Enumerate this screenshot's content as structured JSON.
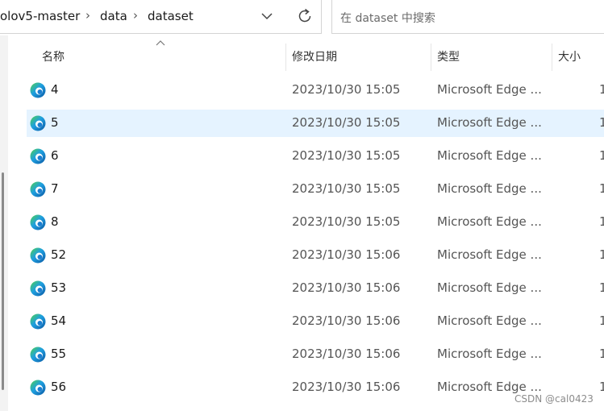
{
  "breadcrumb": [
    "olov5-master",
    "data",
    "dataset"
  ],
  "search": {
    "placeholder": "在 dataset 中搜索"
  },
  "columns": {
    "name": "名称",
    "date": "修改日期",
    "type": "类型",
    "size": "大小"
  },
  "files": [
    {
      "name": "4",
      "date": "2023/10/30 15:05",
      "type": "Microsoft Edge ...",
      "size": "1"
    },
    {
      "name": "5",
      "date": "2023/10/30 15:05",
      "type": "Microsoft Edge ...",
      "size": "1"
    },
    {
      "name": "6",
      "date": "2023/10/30 15:05",
      "type": "Microsoft Edge ...",
      "size": "1"
    },
    {
      "name": "7",
      "date": "2023/10/30 15:05",
      "type": "Microsoft Edge ...",
      "size": "1"
    },
    {
      "name": "8",
      "date": "2023/10/30 15:05",
      "type": "Microsoft Edge ...",
      "size": "1"
    },
    {
      "name": "52",
      "date": "2023/10/30 15:06",
      "type": "Microsoft Edge ...",
      "size": "1"
    },
    {
      "name": "53",
      "date": "2023/10/30 15:06",
      "type": "Microsoft Edge ...",
      "size": "1"
    },
    {
      "name": "54",
      "date": "2023/10/30 15:06",
      "type": "Microsoft Edge ...",
      "size": "1"
    },
    {
      "name": "55",
      "date": "2023/10/30 15:06",
      "type": "Microsoft Edge ...",
      "size": "1"
    },
    {
      "name": "56",
      "date": "2023/10/30 15:06",
      "type": "Microsoft Edge ...",
      "size": "1"
    }
  ],
  "selected_file": "5",
  "file_icon": "microsoft-edge-icon",
  "colors": {
    "selection": "#e5f3ff",
    "edge_blue": "#0c59a4",
    "edge_green": "#4fd24b"
  },
  "watermark": "CSDN @cal0423"
}
